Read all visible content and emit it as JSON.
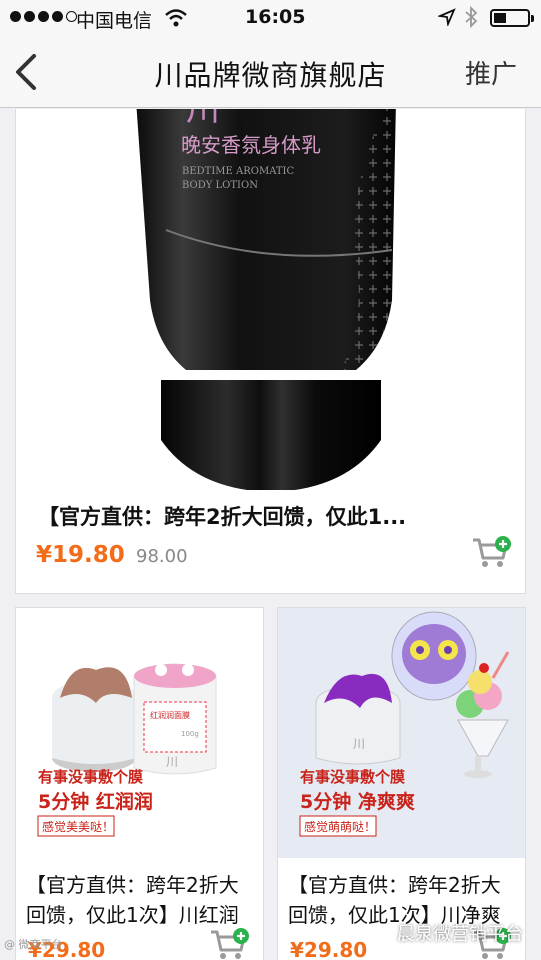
{
  "status_bar": {
    "carrier": "中国电信",
    "time": "16:05"
  },
  "nav": {
    "title": "川品牌微商旗舰店",
    "right_action": "推广"
  },
  "products": [
    {
      "title": "【官方直供：跨年2折大回馈，仅此1...",
      "price": "¥19.80",
      "original_price": "98.00",
      "image_text": {
        "brand": "川",
        "name": "晚安香氛身体乳",
        "english_1": "BEDTIME AROMATIC",
        "english_2": "BODY LOTION"
      }
    },
    {
      "title": "【官方直供：跨年2折大回馈，仅此1次】川红润",
      "price": "¥29.80",
      "image_text": {
        "line1": "有事没事敷个膜",
        "line2": "5分钟  红润润",
        "line3": "感觉美美哒！",
        "jar_label": "红润润面膜",
        "jar_weight": "100g",
        "jar_brand": "川"
      }
    },
    {
      "title": "【官方直供：跨年2折大回馈，仅此1次】川净爽",
      "price": "¥29.80",
      "image_text": {
        "line1": "有事没事敷个膜",
        "line2": "5分钟  净爽爽",
        "line3": "感觉萌萌哒！",
        "jar_brand": "川"
      }
    }
  ],
  "watermark": "晨泉微营销平台",
  "corner_mark": "@ 微商平台",
  "colors": {
    "price": "#f26c1a",
    "cart": "#9a9a9a",
    "plus": "#2bb24c"
  }
}
